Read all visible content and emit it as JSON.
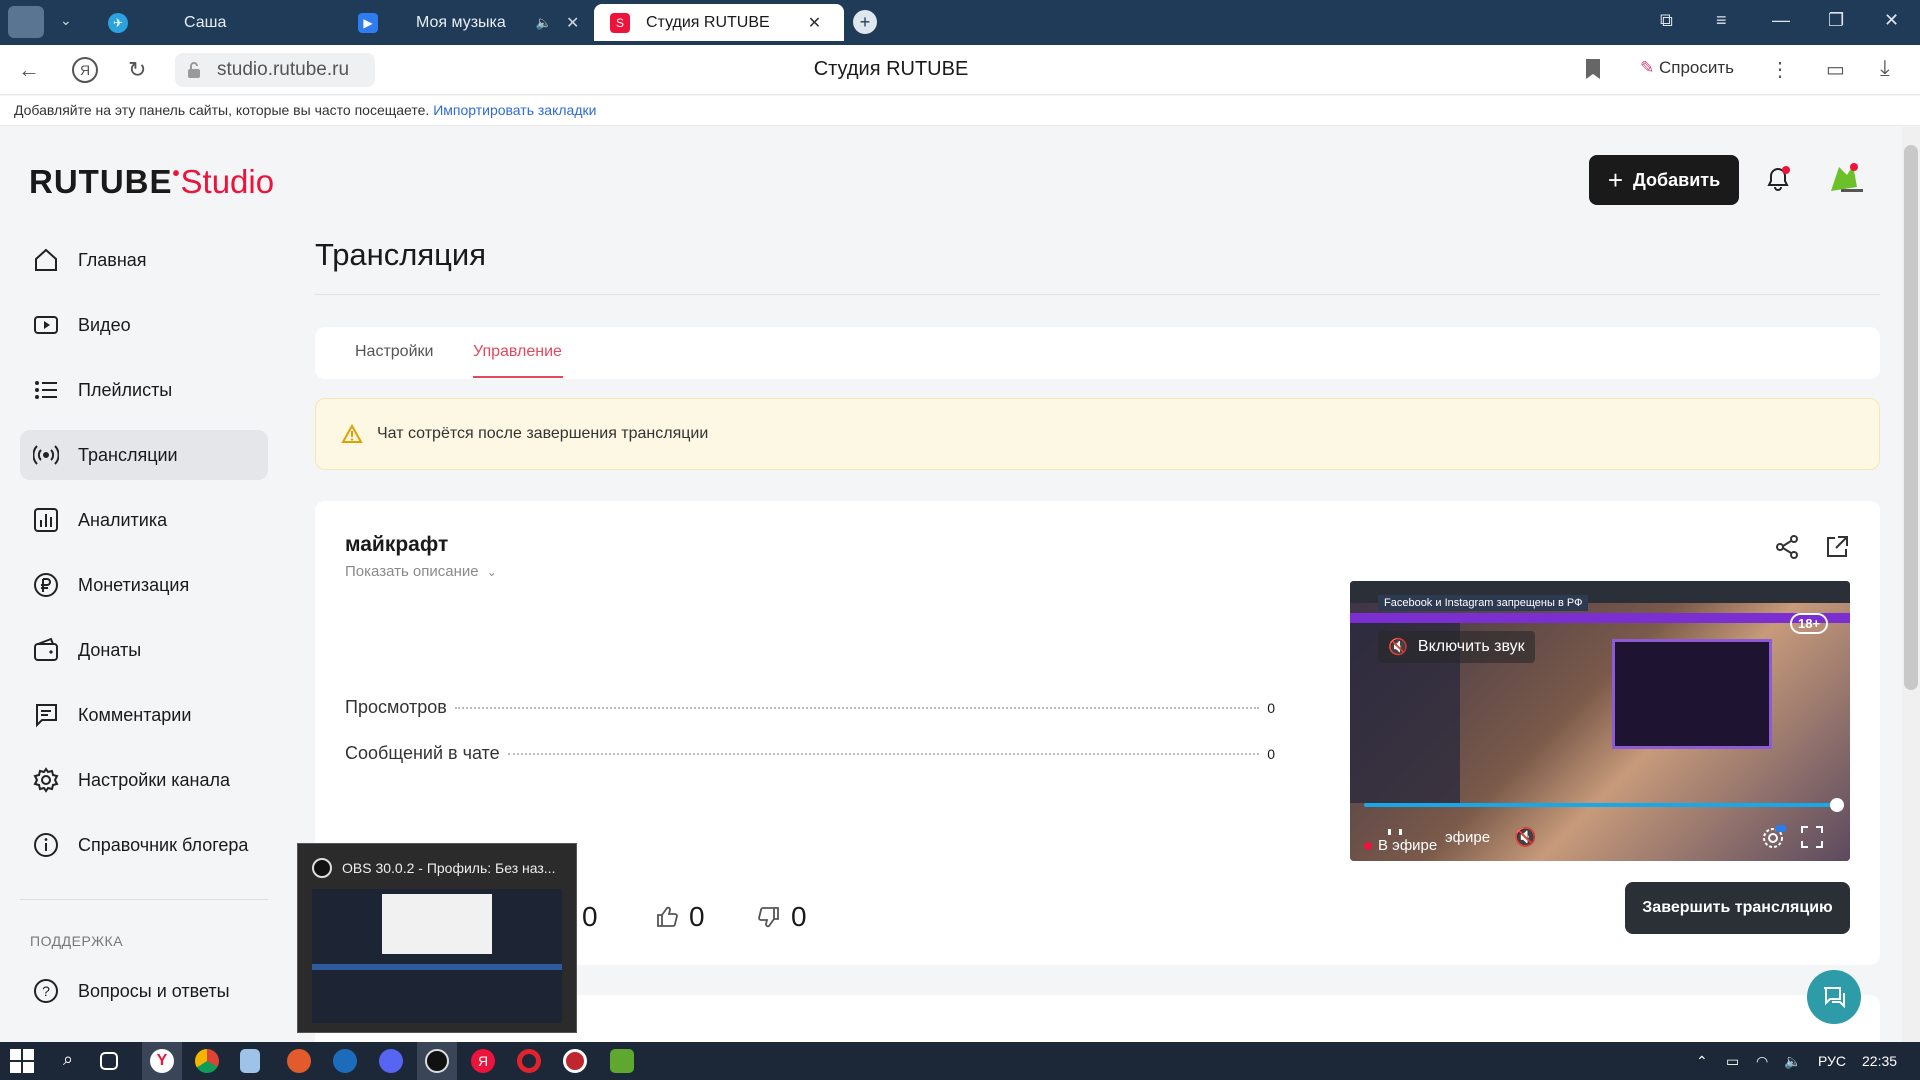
{
  "browser": {
    "tabs": [
      {
        "label": "Саша",
        "color": "#2aa3df"
      },
      {
        "label": "Моя музыка",
        "color": "#2f7cf0"
      },
      {
        "label": "Студия RUTUBE",
        "color": "#ed143b"
      }
    ],
    "url": "studio.rutube.ru",
    "page_title": "Студия RUTUBE",
    "ask_label": "Спросить",
    "bookmarks_text": "Добавляйте на эту панель сайты, которые вы часто посещаете.",
    "bookmarks_link": "Импортировать закладки"
  },
  "header": {
    "logo_main": "RUTUBE",
    "logo_studio": "Studio",
    "add_label": "Добавить"
  },
  "sidebar": {
    "items": [
      {
        "label": "Главная",
        "icon": "home-icon"
      },
      {
        "label": "Видео",
        "icon": "video-icon"
      },
      {
        "label": "Плейлисты",
        "icon": "playlist-icon"
      },
      {
        "label": "Трансляции",
        "icon": "broadcast-icon"
      },
      {
        "label": "Аналитика",
        "icon": "analytics-icon"
      },
      {
        "label": "Монетизация",
        "icon": "ruble-icon"
      },
      {
        "label": "Донаты",
        "icon": "wallet-icon"
      },
      {
        "label": "Комментарии",
        "icon": "comment-icon"
      },
      {
        "label": "Настройки канала",
        "icon": "gear-icon"
      },
      {
        "label": "Справочник блогера",
        "icon": "info-icon"
      }
    ],
    "support_label": "ПОДДЕРЖКА",
    "faq_label": "Вопросы и ответы"
  },
  "main": {
    "title": "Трансляция",
    "tabs": [
      "Настройки",
      "Управление"
    ],
    "warning": "Чат сотрётся после завершения трансляции",
    "stream": {
      "name": "майкрафт",
      "show_description": "Показать описание",
      "stats": [
        {
          "label": "Просмотров",
          "value": "0"
        },
        {
          "label": "Сообщений в чате",
          "value": "0"
        }
      ],
      "reactions": {
        "views": "0",
        "likes": "0",
        "dislikes": "0"
      },
      "end_label": "Завершить трансляцию"
    },
    "player": {
      "banner": "Facebook и Instagram запрещены в РФ",
      "age": "18+",
      "unmute": "Включить звук",
      "live": "В эфире",
      "live_partial": "эфире"
    }
  },
  "obs_preview": {
    "title": "OBS 30.0.2 - Профиль: Без наз..."
  },
  "taskbar": {
    "lang": "РУС",
    "clock": "22:35"
  }
}
